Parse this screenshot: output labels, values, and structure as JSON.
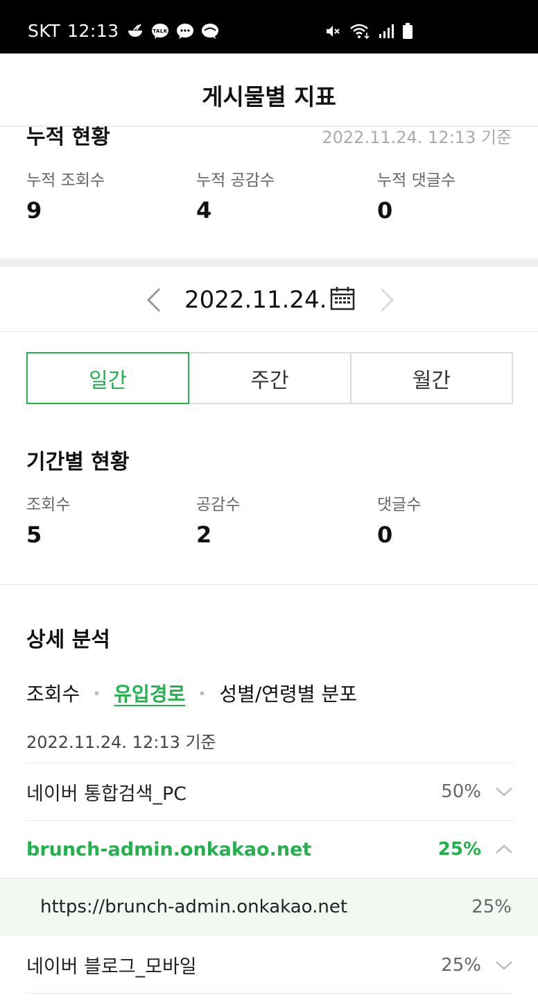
{
  "status_bar": {
    "carrier": "SKT",
    "time": "12:13"
  },
  "header": {
    "title": "게시물별 지표"
  },
  "cumulative": {
    "title": "누적 현황",
    "timestamp": "2022.11.24. 12:13 기준",
    "stats": [
      {
        "label": "누적 조회수",
        "value": "9"
      },
      {
        "label": "누적 공감수",
        "value": "4"
      },
      {
        "label": "누적 댓글수",
        "value": "0"
      }
    ]
  },
  "date_nav": {
    "date": "2022.11.24."
  },
  "period_tabs": [
    {
      "label": "일간",
      "active": true
    },
    {
      "label": "주간",
      "active": false
    },
    {
      "label": "월간",
      "active": false
    }
  ],
  "period": {
    "title": "기간별 현황",
    "stats": [
      {
        "label": "조회수",
        "value": "5"
      },
      {
        "label": "공감수",
        "value": "2"
      },
      {
        "label": "댓글수",
        "value": "0"
      }
    ]
  },
  "detail": {
    "title": "상세 분석",
    "subtabs": [
      "조회수",
      "유입경로",
      "성별/연령별 분포"
    ],
    "basis": "2022.11.24. 12:13 기준",
    "rows": [
      {
        "name": "네이버 통합검색_PC",
        "pct": "50%"
      },
      {
        "name": "brunch-admin.onkakao.net",
        "pct": "25%"
      },
      {
        "name": "https://brunch-admin.onkakao.net",
        "pct": "25%"
      },
      {
        "name": "네이버 블로그_모바일",
        "pct": "25%"
      }
    ]
  },
  "colors": {
    "accent": "#22b24c"
  }
}
